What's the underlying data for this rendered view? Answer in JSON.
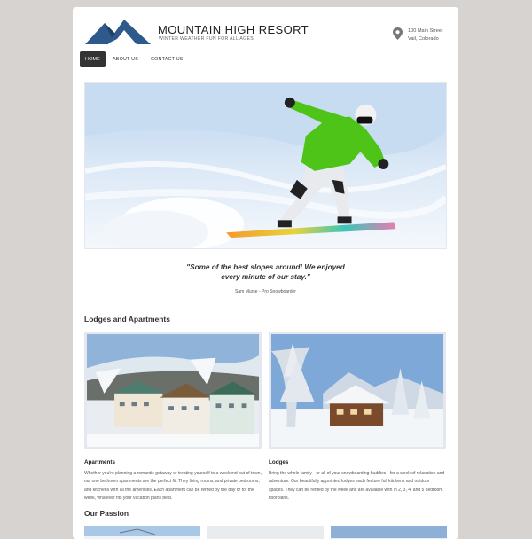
{
  "header": {
    "title": "MOUNTAIN HIGH RESORT",
    "subtitle": "WINTER WEATHER FUN FOR ALL AGES",
    "address_line1": "100 Main Street",
    "address_line2": "Vail, Colorado"
  },
  "nav": {
    "items": [
      {
        "label": "HOME",
        "active": true
      },
      {
        "label": "ABOUT US",
        "active": false
      },
      {
        "label": "CONTACT US",
        "active": false
      }
    ]
  },
  "testimonial": {
    "quote_line1": "\"Some of the best slopes around! We enjoyed",
    "quote_line2": "every minute of our stay.\"",
    "author": "Sam Murse - Pro Snowboarder"
  },
  "lodges": {
    "heading": "Lodges and Apartments",
    "cards": [
      {
        "title": "Apartments",
        "text": "Whether you're planning a romantic getaway or treating yourself to a weekend out of town, our one bedroom apartments are the perfect fit. They living rooms, and private bedrooms, and kitchens with all the amenities. Each apartment can be rented by the day or for the week, whatever fits your vacation plans best."
      },
      {
        "title": "Lodges",
        "text": "Bring the whole family - or all of your snowboarding buddies - for a week of relaxation and adventure. Our beautifully appointed lodges each feature full kitchens and outdoor spaces. They can be rented by the week and are available with in 2, 3, 4, and 5 bedroom floorplans."
      }
    ]
  },
  "passion": {
    "heading": "Our Passion"
  },
  "colors": {
    "logo_blue": "#2d5a8a",
    "nav_active": "#333333",
    "jacket_green": "#4ec318"
  }
}
